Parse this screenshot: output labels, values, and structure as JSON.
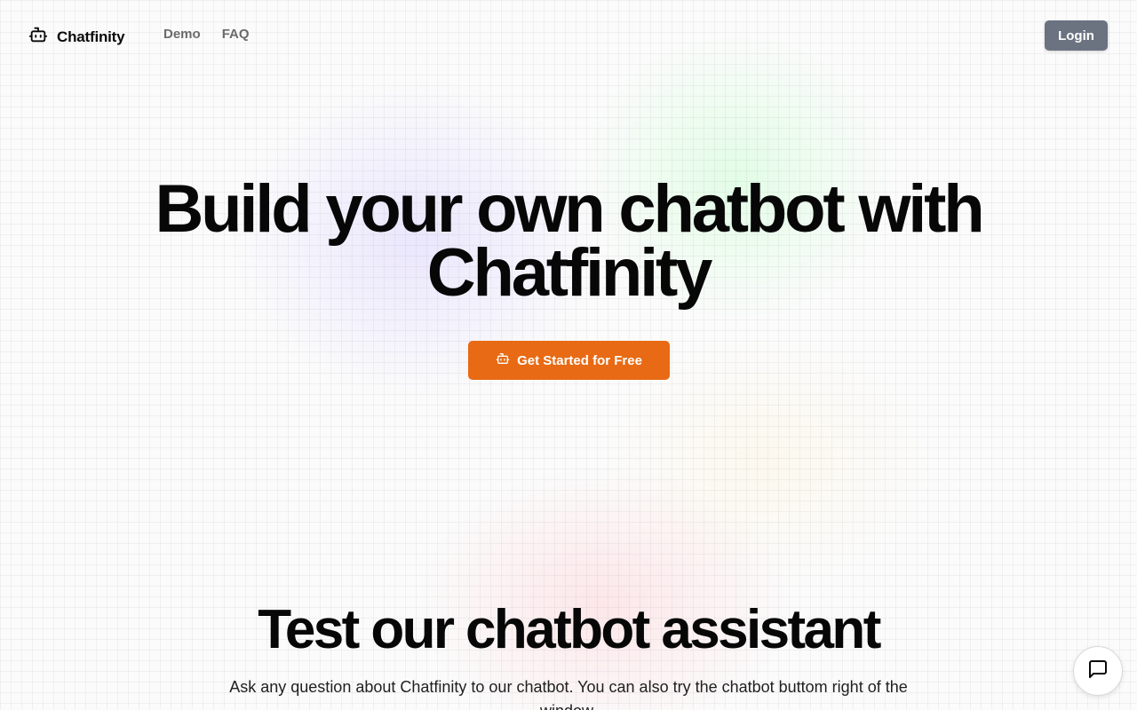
{
  "header": {
    "brand_name": "Chatfinity",
    "brand_icon": "bot-icon",
    "nav": [
      {
        "label": "Demo"
      },
      {
        "label": "FAQ"
      }
    ],
    "login_label": "Login"
  },
  "hero": {
    "title_line1": "Build your own chatbot with",
    "title_line2": "Chatfinity",
    "cta_label": "Get Started for Free",
    "cta_icon": "bot-icon"
  },
  "demo_section": {
    "title": "Test our chatbot assistant",
    "description": "Ask any question about Chatfinity to our chatbot. You can also try the chatbot buttom right of the window."
  },
  "chat_launcher": {
    "icon": "message-square-icon"
  },
  "colors": {
    "cta": "#e86a14",
    "login": "#6b7280",
    "nav_text": "#6b6b6b",
    "heading": "#070707"
  }
}
